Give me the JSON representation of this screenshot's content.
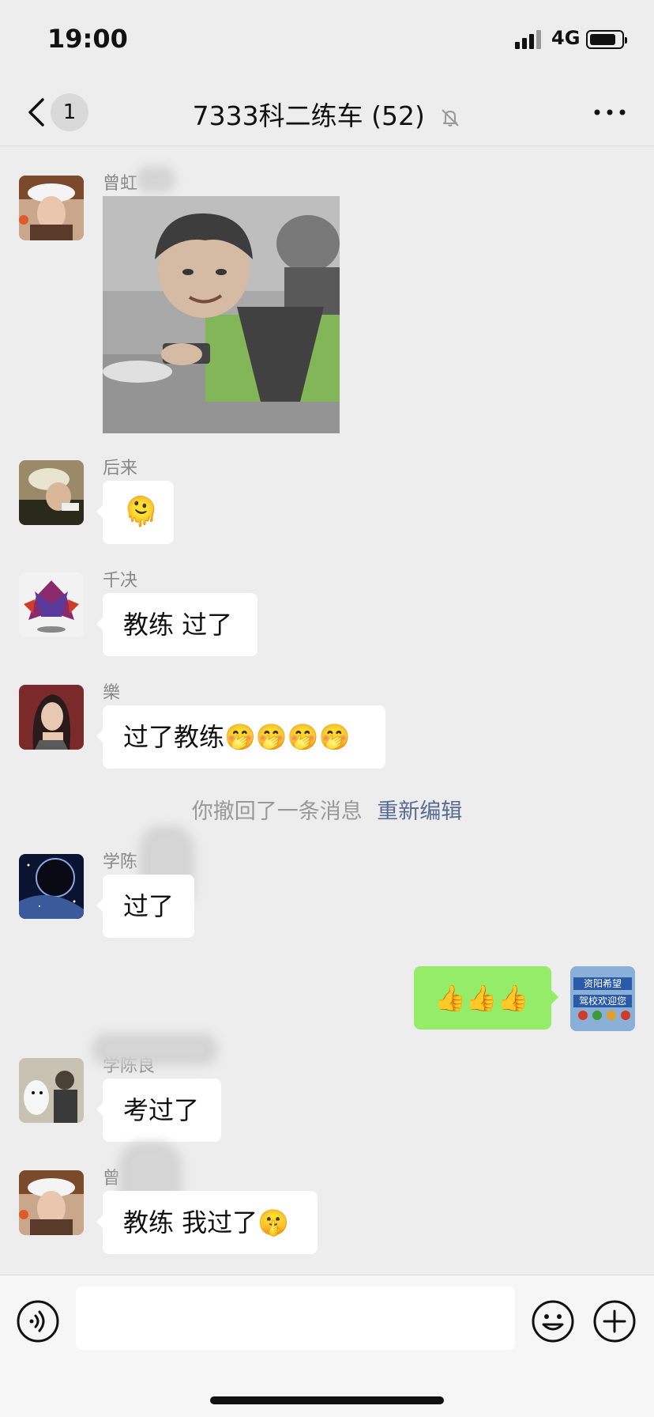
{
  "status_bar": {
    "time": "19:00",
    "network": "4G",
    "battery_level": 0.85
  },
  "header": {
    "title": "7333科二练车 (52)",
    "unread_count": "1",
    "icons": {
      "back": "chevron-left-icon",
      "mute": "bell-slash-icon",
      "more": "ellipsis-icon"
    }
  },
  "messages": [
    {
      "sender": "曾虹",
      "type": "image",
      "image_desc": "photo"
    },
    {
      "sender": "后来",
      "type": "emoji",
      "content": "🫠"
    },
    {
      "sender": "千决",
      "type": "text",
      "content": "教练 过了"
    },
    {
      "sender": "樂",
      "type": "text",
      "content": "过了教练🤭🤭🤭🤭"
    },
    {
      "sender": "",
      "type": "system",
      "content": "你撤回了一条消息",
      "action": "重新编辑"
    },
    {
      "sender": "学陈",
      "type": "text",
      "content": "过了"
    },
    {
      "sender": "me",
      "type": "text",
      "content": "👍👍👍"
    },
    {
      "sender": "学陈良",
      "type": "text",
      "content": "考过了"
    },
    {
      "sender": "曾",
      "type": "text",
      "content": "教练 我过了🤫"
    }
  ],
  "self_avatar_text": {
    "line1": "资阳希望",
    "line2": "驾校欢迎您"
  },
  "input_bar": {
    "placeholder": "",
    "icons": [
      "voice-icon",
      "emoji-icon",
      "plus-icon"
    ]
  },
  "colors": {
    "background": "#ededed",
    "bubble_self": "#95ec69",
    "bubble_other": "#ffffff",
    "link": "#576b95"
  }
}
